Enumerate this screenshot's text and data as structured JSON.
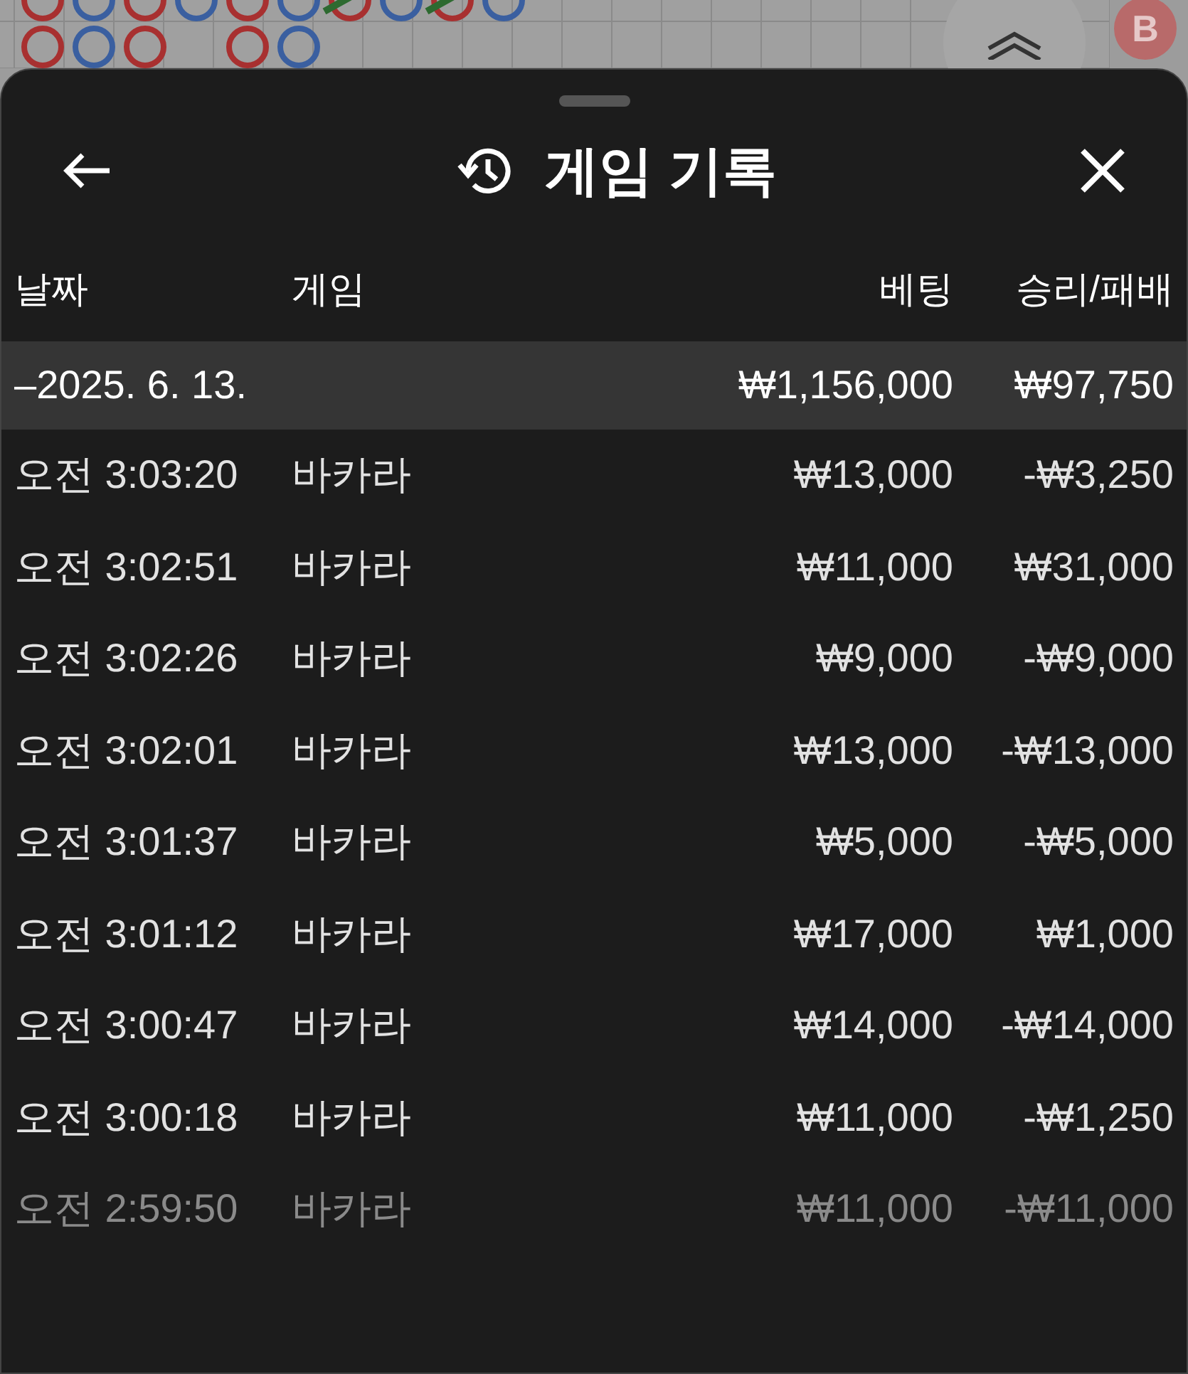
{
  "background": {
    "badge": "B"
  },
  "sheet": {
    "title": "게임 기록",
    "columns": [
      "날짜",
      "게임",
      "베팅",
      "승리/패배"
    ],
    "group": {
      "date": "–2025. 6. 13.",
      "bet": "₩1,156,000",
      "result": "₩97,750"
    },
    "rows": [
      {
        "time": "오전 3:03:20",
        "game": "바카라",
        "bet": "₩13,000",
        "result": "-₩3,250",
        "faded": false
      },
      {
        "time": "오전 3:02:51",
        "game": "바카라",
        "bet": "₩11,000",
        "result": "₩31,000",
        "faded": false
      },
      {
        "time": "오전 3:02:26",
        "game": "바카라",
        "bet": "₩9,000",
        "result": "-₩9,000",
        "faded": false
      },
      {
        "time": "오전 3:02:01",
        "game": "바카라",
        "bet": "₩13,000",
        "result": "-₩13,000",
        "faded": false
      },
      {
        "time": "오전 3:01:37",
        "game": "바카라",
        "bet": "₩5,000",
        "result": "-₩5,000",
        "faded": false
      },
      {
        "time": "오전 3:01:12",
        "game": "바카라",
        "bet": "₩17,000",
        "result": "₩1,000",
        "faded": false
      },
      {
        "time": "오전 3:00:47",
        "game": "바카라",
        "bet": "₩14,000",
        "result": "-₩14,000",
        "faded": false
      },
      {
        "time": "오전 3:00:18",
        "game": "바카라",
        "bet": "₩11,000",
        "result": "-₩1,250",
        "faded": false
      },
      {
        "time": "오전 2:59:50",
        "game": "바카라",
        "bet": "₩11,000",
        "result": "-₩11,000",
        "faded": true
      }
    ]
  }
}
